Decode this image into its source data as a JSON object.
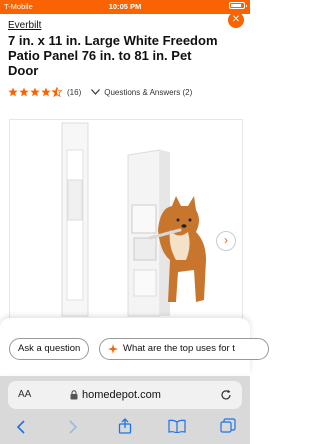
{
  "status_bar": {
    "carrier": "T-Mobile",
    "time": "10:05 PM"
  },
  "product": {
    "brand": "Everbilt",
    "title": "7 in. x 11 in. Large White Freedom Patio Panel 76 in. to 81 in. Pet Door",
    "rating": 4.5,
    "review_count": "(16)",
    "qa_label": "Questions & Answers (2)"
  },
  "chips": {
    "ask": "Ask a question",
    "top_uses": "What are the top uses for t"
  },
  "browser": {
    "aa_label": "AA",
    "url": "homedepot.com"
  },
  "colors": {
    "brand_orange": "#f96302",
    "browser_bar": "#d9d9d9"
  },
  "icons": [
    "close-icon",
    "chevron-down-icon",
    "chevron-right-icon",
    "lock-icon",
    "reload-icon",
    "back-icon",
    "forward-icon",
    "share-icon",
    "bookmarks-icon",
    "tabs-icon"
  ]
}
